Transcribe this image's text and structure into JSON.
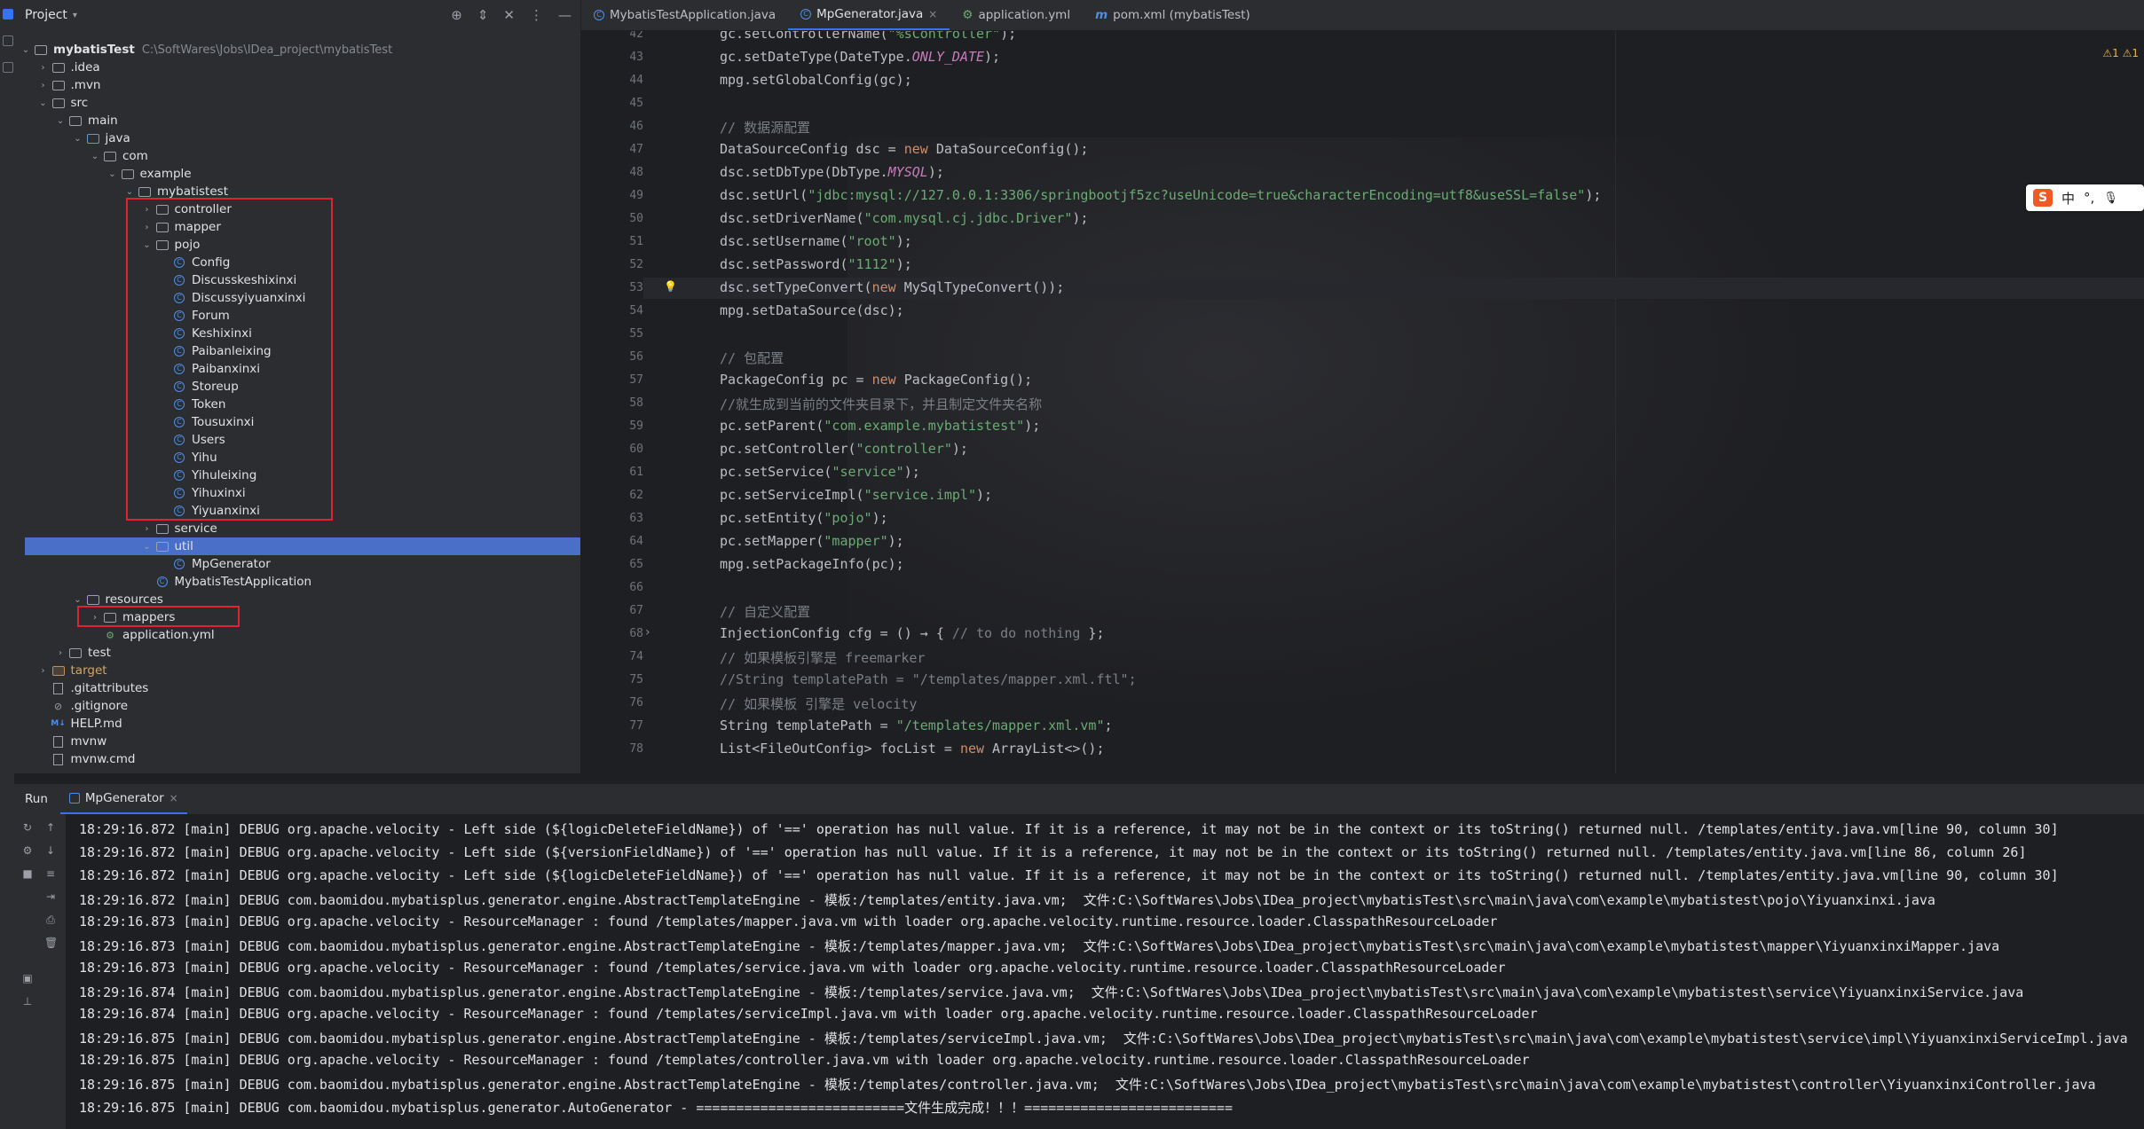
{
  "project_panel": {
    "title": "Project",
    "tree": [
      {
        "label": "mybatisTest",
        "path": "C:\\SoftWares\\Jobs\\IDea_project\\mybatisTest",
        "type": "module",
        "depth": 0,
        "expanded": true
      },
      {
        "label": ".idea",
        "type": "folder",
        "depth": 1,
        "expanded": false
      },
      {
        "label": ".mvn",
        "type": "folder",
        "depth": 1,
        "expanded": false
      },
      {
        "label": "src",
        "type": "folder",
        "depth": 1,
        "expanded": true
      },
      {
        "label": "main",
        "type": "folder",
        "depth": 2,
        "expanded": true
      },
      {
        "label": "java",
        "type": "src-folder",
        "depth": 3,
        "expanded": true
      },
      {
        "label": "com",
        "type": "package",
        "depth": 4,
        "expanded": true
      },
      {
        "label": "example",
        "type": "package",
        "depth": 5,
        "expanded": true
      },
      {
        "label": "mybatistest",
        "type": "package",
        "depth": 6,
        "expanded": true
      },
      {
        "label": "controller",
        "type": "package",
        "depth": 7,
        "expanded": false
      },
      {
        "label": "mapper",
        "type": "package",
        "depth": 7,
        "expanded": false
      },
      {
        "label": "pojo",
        "type": "package",
        "depth": 7,
        "expanded": true
      },
      {
        "label": "Config",
        "type": "class",
        "depth": 8
      },
      {
        "label": "Discusskeshixinxi",
        "type": "class",
        "depth": 8
      },
      {
        "label": "Discussyiyuanxinxi",
        "type": "class",
        "depth": 8
      },
      {
        "label": "Forum",
        "type": "class",
        "depth": 8
      },
      {
        "label": "Keshixinxi",
        "type": "class",
        "depth": 8
      },
      {
        "label": "Paibanleixing",
        "type": "class",
        "depth": 8
      },
      {
        "label": "Paibanxinxi",
        "type": "class",
        "depth": 8
      },
      {
        "label": "Storeup",
        "type": "class",
        "depth": 8
      },
      {
        "label": "Token",
        "type": "class",
        "depth": 8
      },
      {
        "label": "Tousuxinxi",
        "type": "class",
        "depth": 8
      },
      {
        "label": "Users",
        "type": "class",
        "depth": 8
      },
      {
        "label": "Yihu",
        "type": "class",
        "depth": 8
      },
      {
        "label": "Yihuleixing",
        "type": "class",
        "depth": 8
      },
      {
        "label": "Yihuxinxi",
        "type": "class",
        "depth": 8
      },
      {
        "label": "Yiyuanxinxi",
        "type": "class",
        "depth": 8
      },
      {
        "label": "service",
        "type": "package",
        "depth": 7,
        "expanded": false
      },
      {
        "label": "util",
        "type": "package",
        "depth": 7,
        "expanded": true,
        "selected": true
      },
      {
        "label": "MpGenerator",
        "type": "class",
        "depth": 8
      },
      {
        "label": "MybatisTestApplication",
        "type": "app-class",
        "depth": 7
      },
      {
        "label": "resources",
        "type": "res-folder",
        "depth": 3,
        "expanded": true
      },
      {
        "label": "mappers",
        "type": "folder",
        "depth": 4,
        "expanded": false
      },
      {
        "label": "application.yml",
        "type": "yml",
        "depth": 4
      },
      {
        "label": "test",
        "type": "folder",
        "depth": 2,
        "expanded": false
      },
      {
        "label": "target",
        "type": "target-folder",
        "depth": 1,
        "expanded": false
      },
      {
        "label": ".gitattributes",
        "type": "file",
        "depth": 1
      },
      {
        "label": ".gitignore",
        "type": "gitignore",
        "depth": 1
      },
      {
        "label": "HELP.md",
        "type": "md",
        "depth": 1
      },
      {
        "label": "mvnw",
        "type": "file",
        "depth": 1
      },
      {
        "label": "mvnw.cmd",
        "type": "file",
        "depth": 1
      }
    ]
  },
  "editor_tabs": [
    {
      "label": "MybatisTestApplication.java",
      "active": false
    },
    {
      "label": "MpGenerator.java",
      "active": true,
      "close": "×"
    },
    {
      "label": "application.yml",
      "active": false
    },
    {
      "label": "pom.xml (mybatisTest)",
      "active": false
    }
  ],
  "editor": {
    "warnings": "⚠1 ⚠1",
    "highlighted_line": "53",
    "lines": [
      {
        "n": "42",
        "tokens": [
          [
            "",
            "gc.setControllerName("
          ],
          [
            "s",
            "\"%sController\""
          ],
          [
            "",
            ");"
          ]
        ]
      },
      {
        "n": "43",
        "tokens": [
          [
            "",
            "gc.setDateType(DateType."
          ],
          [
            "f",
            "ONLY_DATE"
          ],
          [
            "",
            ");"
          ]
        ]
      },
      {
        "n": "44",
        "tokens": [
          [
            "",
            "mpg.setGlobalConfig(gc);"
          ]
        ]
      },
      {
        "n": "45",
        "tokens": []
      },
      {
        "n": "46",
        "tokens": [
          [
            "c",
            "// 数据源配置"
          ]
        ]
      },
      {
        "n": "47",
        "tokens": [
          [
            "",
            "DataSourceConfig dsc = "
          ],
          [
            "k",
            "new"
          ],
          [
            "",
            " DataSourceConfig();"
          ]
        ]
      },
      {
        "n": "48",
        "tokens": [
          [
            "",
            "dsc.setDbType(DbType."
          ],
          [
            "f",
            "MYSQL"
          ],
          [
            "",
            ");"
          ]
        ]
      },
      {
        "n": "49",
        "tokens": [
          [
            "",
            "dsc.setUrl("
          ],
          [
            "s",
            "\"jdbc:mysql://127.0.0.1:3306/springbootjf5zc?useUnicode=true&characterEncoding=utf8&useSSL=false\""
          ],
          [
            "",
            ");"
          ]
        ]
      },
      {
        "n": "50",
        "tokens": [
          [
            "",
            "dsc.setDriverName("
          ],
          [
            "s",
            "\"com.mysql.cj.jdbc.Driver\""
          ],
          [
            "",
            ");"
          ]
        ]
      },
      {
        "n": "51",
        "tokens": [
          [
            "",
            "dsc.setUsername("
          ],
          [
            "s",
            "\"root\""
          ],
          [
            "",
            ");"
          ]
        ]
      },
      {
        "n": "52",
        "tokens": [
          [
            "",
            "dsc.setPassword("
          ],
          [
            "s",
            "\"1112\""
          ],
          [
            "",
            ");"
          ]
        ]
      },
      {
        "n": "53",
        "tokens": [
          [
            "",
            "dsc.setTypeConvert("
          ],
          [
            "k",
            "new"
          ],
          [
            "",
            " MySqlTypeConvert());"
          ]
        ]
      },
      {
        "n": "54",
        "tokens": [
          [
            "",
            "mpg.setDataSource(dsc);"
          ]
        ]
      },
      {
        "n": "55",
        "tokens": []
      },
      {
        "n": "56",
        "tokens": [
          [
            "c",
            "// 包配置"
          ]
        ]
      },
      {
        "n": "57",
        "tokens": [
          [
            "",
            "PackageConfig pc = "
          ],
          [
            "k",
            "new"
          ],
          [
            "",
            " PackageConfig();"
          ]
        ]
      },
      {
        "n": "58",
        "tokens": [
          [
            "c",
            "//就生成到当前的文件夹目录下，并且制定文件夹名称"
          ]
        ]
      },
      {
        "n": "59",
        "tokens": [
          [
            "",
            "pc.setParent("
          ],
          [
            "s",
            "\"com.example.mybatistest\""
          ],
          [
            "",
            ");"
          ]
        ]
      },
      {
        "n": "60",
        "tokens": [
          [
            "",
            "pc.setController("
          ],
          [
            "s",
            "\"controller\""
          ],
          [
            "",
            ");"
          ]
        ]
      },
      {
        "n": "61",
        "tokens": [
          [
            "",
            "pc.setService("
          ],
          [
            "s",
            "\"service\""
          ],
          [
            "",
            ");"
          ]
        ]
      },
      {
        "n": "62",
        "tokens": [
          [
            "",
            "pc.setServiceImpl("
          ],
          [
            "s",
            "\"service.impl\""
          ],
          [
            "",
            ");"
          ]
        ]
      },
      {
        "n": "63",
        "tokens": [
          [
            "",
            "pc.setEntity("
          ],
          [
            "s",
            "\"pojo\""
          ],
          [
            "",
            ");"
          ]
        ]
      },
      {
        "n": "64",
        "tokens": [
          [
            "",
            "pc.setMapper("
          ],
          [
            "s",
            "\"mapper\""
          ],
          [
            "",
            ");"
          ]
        ]
      },
      {
        "n": "65",
        "tokens": [
          [
            "",
            "mpg.setPackageInfo(pc);"
          ]
        ]
      },
      {
        "n": "66",
        "tokens": []
      },
      {
        "n": "67",
        "tokens": [
          [
            "c",
            "// 自定义配置"
          ]
        ]
      },
      {
        "n": "68",
        "tokens": [
          [
            "",
            "InjectionConfig cfg = () → { "
          ],
          [
            "c",
            "// to do nothing"
          ],
          [
            "",
            " };"
          ]
        ]
      },
      {
        "n": "74",
        "tokens": [
          [
            "c",
            "// 如果模板引擎是 freemarker"
          ]
        ]
      },
      {
        "n": "75",
        "tokens": [
          [
            "c",
            "//String templatePath = \"/templates/mapper.xml.ftl\";"
          ]
        ]
      },
      {
        "n": "76",
        "tokens": [
          [
            "c",
            "// 如果模板 引擎是 velocity"
          ]
        ]
      },
      {
        "n": "77",
        "tokens": [
          [
            "",
            "String templatePath = "
          ],
          [
            "s",
            "\"/templates/mapper.xml.vm\""
          ],
          [
            "",
            ";"
          ]
        ]
      },
      {
        "n": "78",
        "tokens": [
          [
            "",
            "List<FileOutConfig> focList = "
          ],
          [
            "k",
            "new"
          ],
          [
            "",
            " ArrayList<>();"
          ]
        ]
      }
    ]
  },
  "ime": {
    "logo": "S",
    "mode": "中",
    "punct": "°,",
    "mic": "🎙"
  },
  "run_panel": {
    "title": "Run",
    "tab_label": "MpGenerator",
    "tab_close": "×",
    "log_lines": [
      "18:29:16.872 [main] DEBUG org.apache.velocity - Left side (${logicDeleteFieldName}) of '==' operation has null value. If it is a reference, it may not be in the context or its toString() returned null. /templates/entity.java.vm[line 90, column 30]",
      "18:29:16.872 [main] DEBUG org.apache.velocity - Left side (${versionFieldName}) of '==' operation has null value. If it is a reference, it may not be in the context or its toString() returned null. /templates/entity.java.vm[line 86, column 26]",
      "18:29:16.872 [main] DEBUG org.apache.velocity - Left side (${logicDeleteFieldName}) of '==' operation has null value. If it is a reference, it may not be in the context or its toString() returned null. /templates/entity.java.vm[line 90, column 30]",
      "18:29:16.872 [main] DEBUG com.baomidou.mybatisplus.generator.engine.AbstractTemplateEngine - 模板:/templates/entity.java.vm;  文件:C:\\SoftWares\\Jobs\\IDea_project\\mybatisTest\\src\\main\\java\\com\\example\\mybatistest\\pojo\\Yiyuanxinxi.java",
      "18:29:16.873 [main] DEBUG org.apache.velocity - ResourceManager : found /templates/mapper.java.vm with loader org.apache.velocity.runtime.resource.loader.ClasspathResourceLoader",
      "18:29:16.873 [main] DEBUG com.baomidou.mybatisplus.generator.engine.AbstractTemplateEngine - 模板:/templates/mapper.java.vm;  文件:C:\\SoftWares\\Jobs\\IDea_project\\mybatisTest\\src\\main\\java\\com\\example\\mybatistest\\mapper\\YiyuanxinxiMapper.java",
      "18:29:16.873 [main] DEBUG org.apache.velocity - ResourceManager : found /templates/service.java.vm with loader org.apache.velocity.runtime.resource.loader.ClasspathResourceLoader",
      "18:29:16.874 [main] DEBUG com.baomidou.mybatisplus.generator.engine.AbstractTemplateEngine - 模板:/templates/service.java.vm;  文件:C:\\SoftWares\\Jobs\\IDea_project\\mybatisTest\\src\\main\\java\\com\\example\\mybatistest\\service\\YiyuanxinxiService.java",
      "18:29:16.874 [main] DEBUG org.apache.velocity - ResourceManager : found /templates/serviceImpl.java.vm with loader org.apache.velocity.runtime.resource.loader.ClasspathResourceLoader",
      "18:29:16.875 [main] DEBUG com.baomidou.mybatisplus.generator.engine.AbstractTemplateEngine - 模板:/templates/serviceImpl.java.vm;  文件:C:\\SoftWares\\Jobs\\IDea_project\\mybatisTest\\src\\main\\java\\com\\example\\mybatistest\\service\\impl\\YiyuanxinxiServiceImpl.java",
      "18:29:16.875 [main] DEBUG org.apache.velocity - ResourceManager : found /templates/controller.java.vm with loader org.apache.velocity.runtime.resource.loader.ClasspathResourceLoader",
      "18:29:16.875 [main] DEBUG com.baomidou.mybatisplus.generator.engine.AbstractTemplateEngine - 模板:/templates/controller.java.vm;  文件:C:\\SoftWares\\Jobs\\IDea_project\\mybatisTest\\src\\main\\java\\com\\example\\mybatistest\\controller\\YiyuanxinxiController.java",
      "18:29:16.875 [main] DEBUG com.baomidou.mybatisplus.generator.AutoGenerator - ==========================文件生成完成！！！=========================="
    ]
  },
  "colors": {
    "accent": "#3574f0",
    "annotation_box": "#e0242e",
    "panel_bg": "#2b2d30",
    "editor_bg": "#1e1f22",
    "keyword": "#cf8e6d",
    "string": "#6aab73",
    "comment": "#7a7e85"
  }
}
